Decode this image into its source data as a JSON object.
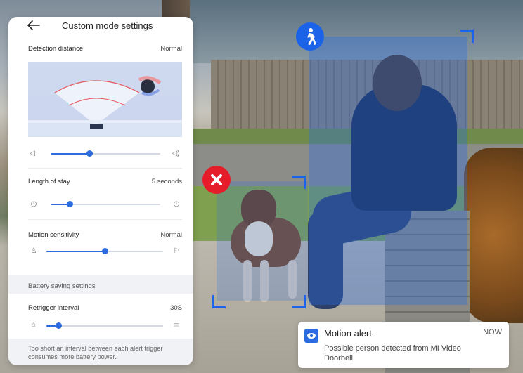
{
  "panel": {
    "title": "Custom mode settings",
    "detection_distance": {
      "label": "Detection distance",
      "value": "Normal",
      "level": 0.35
    },
    "length_of_stay": {
      "label": "Length of stay",
      "value": "5 seconds",
      "level": 0.17
    },
    "motion_sensitivity": {
      "label": "Motion sensitivity",
      "value": "Normal",
      "level": 0.5
    },
    "battery_section": "Battery saving settings",
    "retrigger_interval": {
      "label": "Retrigger interval",
      "value": "30S",
      "level": 0.1
    },
    "footnote": "Too short an interval between each alert trigger consumes more battery power."
  },
  "notification": {
    "title": "Motion alert",
    "time": "NOW",
    "body": "Possible person detected from MI Video Doorbell"
  },
  "colors": {
    "accent": "#2d6be0",
    "person_tag": "#1b63e8",
    "reject_tag": "#e51c2a"
  },
  "icons": [
    "back-arrow-icon",
    "volume-low-icon",
    "volume-high-icon",
    "timer-short-icon",
    "timer-long-icon",
    "person-walking-icon",
    "close-x-icon",
    "camera-eye-icon"
  ]
}
